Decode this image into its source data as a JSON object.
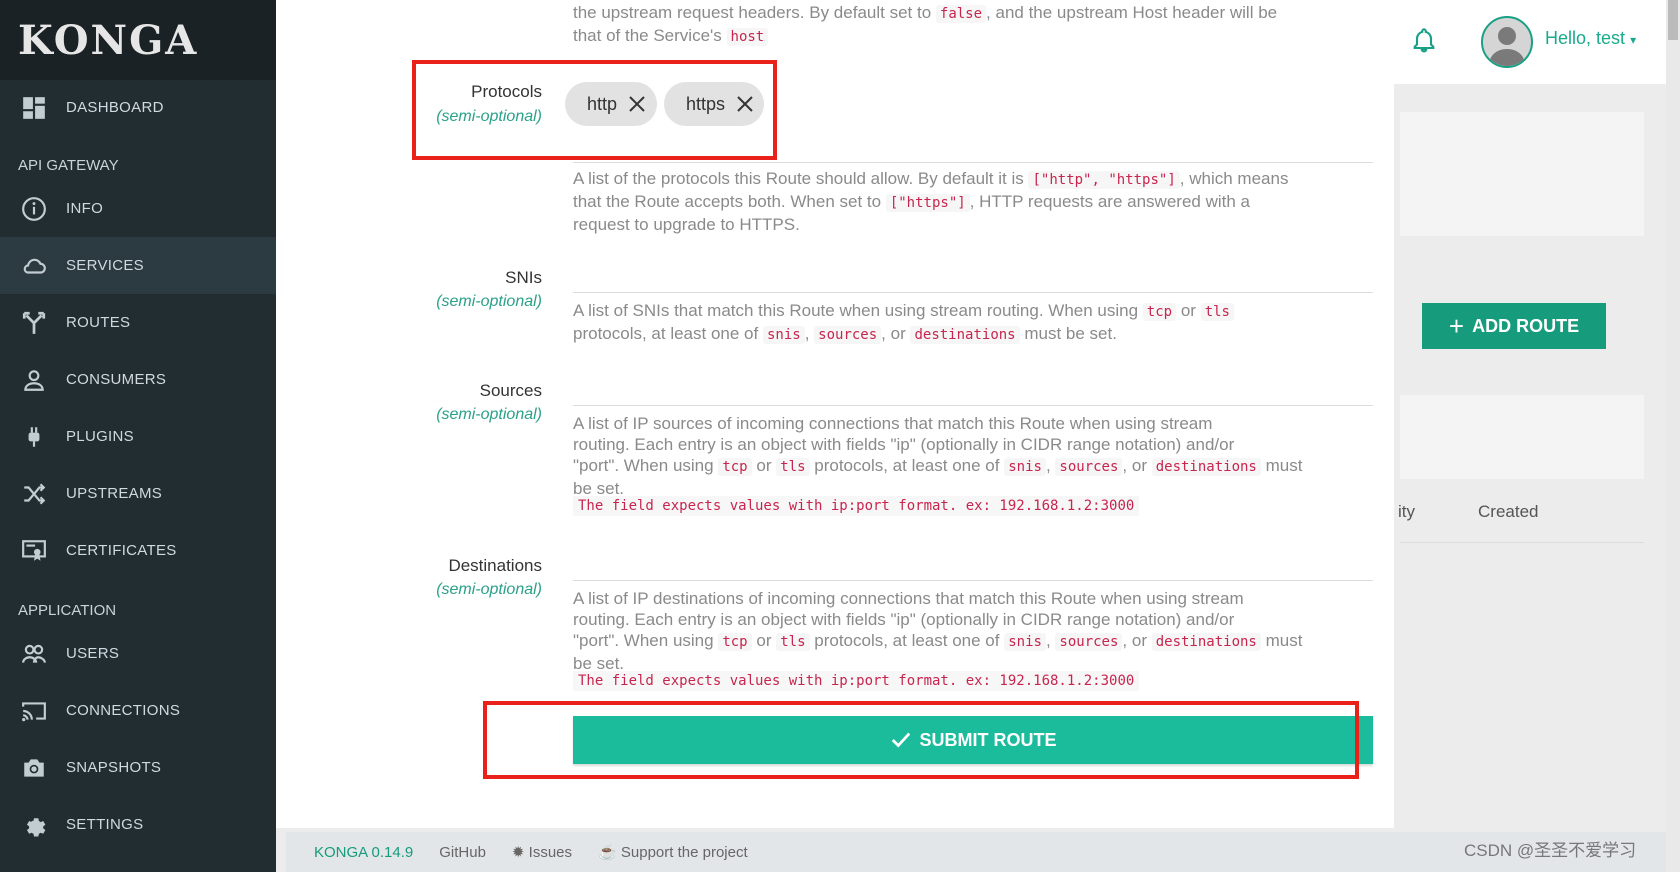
{
  "app": {
    "logo": "KONGA"
  },
  "sidebar": {
    "dashboard": "DASHBOARD",
    "section_api": "API GATEWAY",
    "api_items": [
      "INFO",
      "SERVICES",
      "ROUTES",
      "CONSUMERS",
      "PLUGINS",
      "UPSTREAMS",
      "CERTIFICATES"
    ],
    "section_app": "APPLICATION",
    "app_items": [
      "USERS",
      "CONNECTIONS",
      "SNAPSHOTS",
      "SETTINGS"
    ]
  },
  "topbar": {
    "greeting": "Hello, test"
  },
  "background": {
    "add_route": "ADD ROUTE",
    "col_partial": "ity",
    "col_created": "Created"
  },
  "footer": {
    "version": "KONGA 0.14.9",
    "github": "GitHub",
    "issues": "Issues",
    "support": "Support the project"
  },
  "watermark": "CSDN @圣圣不爱学习",
  "modal": {
    "top_help": {
      "part1": "the upstream request headers. By default set to",
      "code1": "false",
      "part2": ", and the upstream Host header will be",
      "part3": "that of the Service's",
      "code2": "host"
    },
    "protocols": {
      "label": "Protocols",
      "sub": "(semi-optional)",
      "tags": [
        "http",
        "https"
      ],
      "help": {
        "part1": "A list of the protocols this Route should allow. By default it is",
        "code1": "[\"http\", \"https\"]",
        "part2": ", which means",
        "part3": "that the Route accepts both. When set to",
        "code2": "[\"https\"]",
        "part4": ", HTTP requests are answered with a",
        "part5": "request to upgrade to HTTPS."
      }
    },
    "snis": {
      "label": "SNIs",
      "sub": "(semi-optional)",
      "help": {
        "part1": "A list of SNIs that match this Route when using stream routing. When using",
        "code1": "tcp",
        "or": "or",
        "code2": "tls",
        "part2": "protocols, at least one of",
        "code3": "snis",
        "comma": ",",
        "code4": "sources",
        "comma_or": ", or",
        "code5": "destinations",
        "part3": "must be set."
      }
    },
    "sources": {
      "label": "Sources",
      "sub": "(semi-optional)",
      "help": {
        "line1": "A list of IP sources of incoming connections that match this Route when using stream",
        "line2": "routing. Each entry is an object with fields \"ip\" (optionally in CIDR range notation) and/or",
        "line3a": "\"port\". When using",
        "code1": "tcp",
        "or": "or",
        "code2": "tls",
        "line3b": "protocols, at least one of",
        "code3": "snis",
        "comma": ",",
        "code4": "sources",
        "comma_or": ", or",
        "code5": "destinations",
        "line3c": "must",
        "line4": "be set."
      },
      "error": "The field expects values with ip:port format. ex: 192.168.1.2:3000"
    },
    "destinations": {
      "label": "Destinations",
      "sub": "(semi-optional)",
      "help": {
        "line1": "A list of IP destinations of incoming connections that match this Route when using stream",
        "line2": "routing. Each entry is an object with fields \"ip\" (optionally in CIDR range notation) and/or",
        "line3a": "\"port\". When using",
        "code1": "tcp",
        "or": "or",
        "code2": "tls",
        "line3b": "protocols, at least one of",
        "code3": "snis",
        "comma": ",",
        "code4": "sources",
        "comma_or": ", or",
        "code5": "destinations",
        "line3c": "must",
        "line4": "be set."
      },
      "error": "The field expects values with ip:port format. ex: 192.168.1.2:3000"
    },
    "submit": "SUBMIT ROUTE"
  },
  "colors": {
    "accent": "#1abc9c",
    "sidebar": "#222d32",
    "highlight": "#e8211a",
    "code": "#c7254e"
  }
}
